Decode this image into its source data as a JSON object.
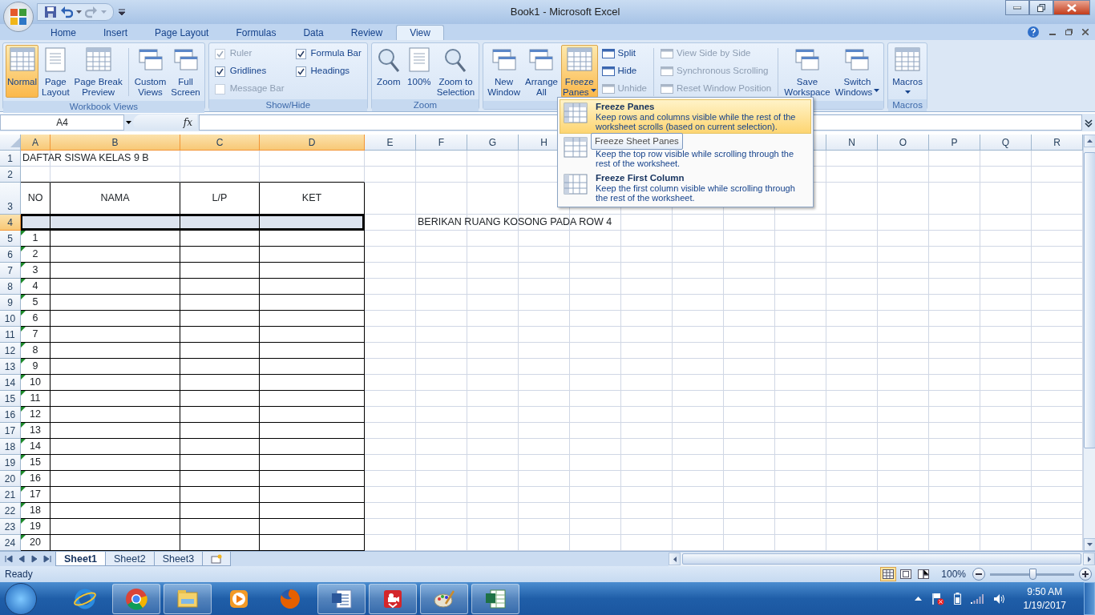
{
  "window": {
    "title": "Book1 - Microsoft Excel"
  },
  "ribbon_tabs": [
    {
      "label": "Home",
      "selected": false
    },
    {
      "label": "Insert",
      "selected": false
    },
    {
      "label": "Page Layout",
      "selected": false
    },
    {
      "label": "Formulas",
      "selected": false
    },
    {
      "label": "Data",
      "selected": false
    },
    {
      "label": "Review",
      "selected": false
    },
    {
      "label": "View",
      "selected": true
    }
  ],
  "ribbon_groups": [
    {
      "label": "Workbook Views",
      "items": [
        {
          "kind": "large",
          "lines": [
            "Normal"
          ],
          "selected": true
        },
        {
          "kind": "large",
          "lines": [
            "Page",
            "Layout"
          ],
          "selected": false
        },
        {
          "kind": "large",
          "lines": [
            "Page Break",
            "Preview"
          ],
          "selected": false
        },
        {
          "kind": "separator"
        },
        {
          "kind": "large",
          "lines": [
            "Custom",
            "Views"
          ],
          "selected": false
        },
        {
          "kind": "large",
          "lines": [
            "Full",
            "Screen"
          ],
          "selected": false
        }
      ]
    },
    {
      "label": "Show/Hide",
      "items": [
        {
          "kind": "check",
          "label": "Ruler",
          "checked": true,
          "disabled": true
        },
        {
          "kind": "check",
          "label": "Gridlines",
          "checked": true,
          "disabled": false
        },
        {
          "kind": "check",
          "label": "Message Bar",
          "checked": false,
          "disabled": true
        },
        {
          "kind": "check",
          "label": "Formula Bar",
          "checked": true,
          "disabled": false
        },
        {
          "kind": "check",
          "label": "Headings",
          "checked": true,
          "disabled": false
        }
      ]
    },
    {
      "label": "Zoom",
      "items": [
        {
          "kind": "large",
          "lines": [
            "Zoom"
          ],
          "selected": false
        },
        {
          "kind": "large",
          "lines": [
            "100%"
          ],
          "selected": false
        },
        {
          "kind": "large",
          "lines": [
            "Zoom to",
            "Selection"
          ],
          "selected": false
        }
      ]
    },
    {
      "items": [
        {
          "kind": "large",
          "lines": [
            "New",
            "Window"
          ],
          "selected": false
        },
        {
          "kind": "large",
          "lines": [
            "Arrange",
            "All"
          ],
          "selected": false
        },
        {
          "kind": "large",
          "lines": [
            "Freeze",
            "Panes"
          ],
          "selected": true,
          "dropdown": true
        },
        {
          "kind": "stack",
          "items": [
            {
              "label": "Split",
              "disabled": false
            },
            {
              "label": "Hide",
              "disabled": false
            },
            {
              "label": "Unhide",
              "disabled": true
            }
          ]
        },
        {
          "kind": "separator"
        },
        {
          "kind": "stack",
          "items": [
            {
              "label": "View Side by Side",
              "disabled": true
            },
            {
              "label": "Synchronous Scrolling",
              "disabled": true
            },
            {
              "label": "Reset Window Position",
              "disabled": true
            }
          ]
        },
        {
          "kind": "separator"
        },
        {
          "kind": "large",
          "lines": [
            "Save",
            "Workspace"
          ],
          "selected": false
        },
        {
          "kind": "large",
          "lines": [
            "Switch",
            "Windows"
          ],
          "selected": false,
          "dropdown": true
        }
      ]
    },
    {
      "label": "Macros",
      "items": [
        {
          "kind": "large",
          "lines": [
            "Macros"
          ],
          "selected": false,
          "dropdown": true
        }
      ]
    }
  ],
  "formula_bar": {
    "name_box": "A4",
    "function_label": "fx"
  },
  "columns": [
    {
      "label": "A",
      "selected": true
    },
    {
      "label": "B",
      "selected": true
    },
    {
      "label": "C",
      "selected": true
    },
    {
      "label": "D",
      "selected": true
    },
    {
      "label": "E",
      "selected": false
    },
    {
      "label": "F",
      "selected": false
    },
    {
      "label": "G",
      "selected": false
    },
    {
      "label": "H",
      "selected": false
    },
    null,
    null,
    null,
    null,
    null,
    {
      "label": "N",
      "selected": false
    },
    {
      "label": "O",
      "selected": false
    },
    {
      "label": "P",
      "selected": false
    },
    {
      "label": "Q",
      "selected": false
    },
    {
      "label": "R",
      "selected": false
    }
  ],
  "rows": [
    {
      "label": "1",
      "selected": false,
      "cells": [
        {
          "text": "DAFTAR SISWA KELAS 9 B"
        }
      ]
    },
    {
      "label": "2",
      "selected": false
    },
    {
      "label": "3",
      "selected": false,
      "tall": true,
      "cells": [
        {
          "text": "NO",
          "bordered": true
        },
        {
          "text": "NAMA",
          "bordered": true
        },
        {
          "text": "L/P",
          "bordered": true
        },
        {
          "text": "KET",
          "bordered": true
        }
      ]
    },
    {
      "label": "4",
      "selected": true,
      "cells": [
        {
          "bordered": true,
          "selected": true
        },
        {
          "bordered": true,
          "selected": true
        },
        {
          "bordered": true,
          "selected": true
        },
        {
          "bordered": true,
          "selected": true
        },
        null,
        {
          "text": "BERIKAN RUANG KOSONG PADA ROW 4"
        }
      ]
    },
    {
      "label": "5",
      "selected": false,
      "cells": [
        {
          "text": "1",
          "bordered": true,
          "flag": true
        },
        {
          "bordered": true
        },
        {
          "bordered": true
        },
        {
          "bordered": true
        }
      ]
    },
    {
      "label": "6",
      "selected": false,
      "cells": [
        {
          "text": "2",
          "bordered": true,
          "flag": true
        },
        {
          "bordered": true
        },
        {
          "bordered": true
        },
        {
          "bordered": true
        }
      ]
    },
    {
      "label": "7",
      "selected": false,
      "cells": [
        {
          "text": "3",
          "bordered": true,
          "flag": true
        },
        {
          "bordered": true
        },
        {
          "bordered": true
        },
        {
          "bordered": true
        }
      ]
    },
    {
      "label": "8",
      "selected": false,
      "cells": [
        {
          "text": "4",
          "bordered": true,
          "flag": true
        },
        {
          "bordered": true
        },
        {
          "bordered": true
        },
        {
          "bordered": true
        }
      ]
    },
    {
      "label": "9",
      "selected": false,
      "cells": [
        {
          "text": "5",
          "bordered": true,
          "flag": true
        },
        {
          "bordered": true
        },
        {
          "bordered": true
        },
        {
          "bordered": true
        }
      ]
    },
    {
      "label": "10",
      "selected": false,
      "cells": [
        {
          "text": "6",
          "bordered": true,
          "flag": true
        },
        {
          "bordered": true
        },
        {
          "bordered": true
        },
        {
          "bordered": true
        }
      ]
    },
    {
      "label": "11",
      "selected": false,
      "cells": [
        {
          "text": "7",
          "bordered": true,
          "flag": true
        },
        {
          "bordered": true
        },
        {
          "bordered": true
        },
        {
          "bordered": true
        }
      ]
    },
    {
      "label": "12",
      "selected": false,
      "cells": [
        {
          "text": "8",
          "bordered": true,
          "flag": true
        },
        {
          "bordered": true
        },
        {
          "bordered": true
        },
        {
          "bordered": true
        }
      ]
    },
    {
      "label": "13",
      "selected": false,
      "cells": [
        {
          "text": "9",
          "bordered": true,
          "flag": true
        },
        {
          "bordered": true
        },
        {
          "bordered": true
        },
        {
          "bordered": true
        }
      ]
    },
    {
      "label": "14",
      "selected": false,
      "cells": [
        {
          "text": "10",
          "bordered": true,
          "flag": true
        },
        {
          "bordered": true
        },
        {
          "bordered": true
        },
        {
          "bordered": true
        }
      ]
    },
    {
      "label": "15",
      "selected": false,
      "cells": [
        {
          "text": "11",
          "bordered": true,
          "flag": true
        },
        {
          "bordered": true
        },
        {
          "bordered": true
        },
        {
          "bordered": true
        }
      ]
    },
    {
      "label": "16",
      "selected": false,
      "cells": [
        {
          "text": "12",
          "bordered": true,
          "flag": true
        },
        {
          "bordered": true
        },
        {
          "bordered": true
        },
        {
          "bordered": true
        }
      ]
    },
    {
      "label": "17",
      "selected": false,
      "cells": [
        {
          "text": "13",
          "bordered": true,
          "flag": true
        },
        {
          "bordered": true
        },
        {
          "bordered": true
        },
        {
          "bordered": true
        }
      ]
    },
    {
      "label": "18",
      "selected": false,
      "cells": [
        {
          "text": "14",
          "bordered": true,
          "flag": true
        },
        {
          "bordered": true
        },
        {
          "bordered": true
        },
        {
          "bordered": true
        }
      ]
    },
    {
      "label": "19",
      "selected": false,
      "cells": [
        {
          "text": "15",
          "bordered": true,
          "flag": true
        },
        {
          "bordered": true
        },
        {
          "bordered": true
        },
        {
          "bordered": true
        }
      ]
    },
    {
      "label": "20",
      "selected": false,
      "cells": [
        {
          "text": "16",
          "bordered": true,
          "flag": true
        },
        {
          "bordered": true
        },
        {
          "bordered": true
        },
        {
          "bordered": true
        }
      ]
    },
    {
      "label": "21",
      "selected": false,
      "cells": [
        {
          "text": "17",
          "bordered": true,
          "flag": true
        },
        {
          "bordered": true
        },
        {
          "bordered": true
        },
        {
          "bordered": true
        }
      ]
    },
    {
      "label": "22",
      "selected": false,
      "cells": [
        {
          "text": "18",
          "bordered": true,
          "flag": true
        },
        {
          "bordered": true
        },
        {
          "bordered": true
        },
        {
          "bordered": true
        }
      ]
    },
    {
      "label": "23",
      "selected": false,
      "cells": [
        {
          "text": "19",
          "bordered": true,
          "flag": true
        },
        {
          "bordered": true
        },
        {
          "bordered": true
        },
        {
          "bordered": true
        }
      ]
    },
    {
      "label": "24",
      "selected": false,
      "cells": [
        {
          "text": "20",
          "bordered": true,
          "flag": true
        },
        {
          "bordered": true
        },
        {
          "bordered": true
        },
        {
          "bordered": true
        }
      ]
    }
  ],
  "menu": {
    "items": [
      {
        "title": "Freeze Panes",
        "description": "Keep rows and columns visible while the rest of the worksheet scrolls (based on current selection).",
        "selected": true
      },
      {
        "description": "Keep the top row visible while scrolling through the rest of the worksheet.",
        "selected": false
      },
      {
        "title": "Freeze First Column",
        "description": "Keep the first column visible while scrolling through the rest of the worksheet.",
        "selected": false
      }
    ]
  },
  "tooltip": {
    "text": "Freeze Sheet Panes"
  },
  "sheet_tabs": [
    {
      "label": "Sheet1",
      "selected": true
    },
    {
      "label": "Sheet2",
      "selected": false
    },
    {
      "label": "Sheet3",
      "selected": false
    }
  ],
  "status_bar": {
    "text": "Ready",
    "views": [
      {
        "selected": true
      },
      {
        "selected": false
      },
      {
        "selected": false
      }
    ],
    "zoom": "100%",
    "zoom_slider": {
      "level": 0.5
    }
  },
  "taskbar": {
    "apps": [
      {
        "running": false
      },
      {
        "running": true
      },
      {
        "running": true
      },
      {
        "running": false
      },
      {
        "running": false
      },
      {
        "running": true
      },
      {
        "running": true
      },
      {
        "running": true
      },
      {
        "running": true
      }
    ],
    "time": "9:50 AM",
    "date": "1/19/2017"
  }
}
